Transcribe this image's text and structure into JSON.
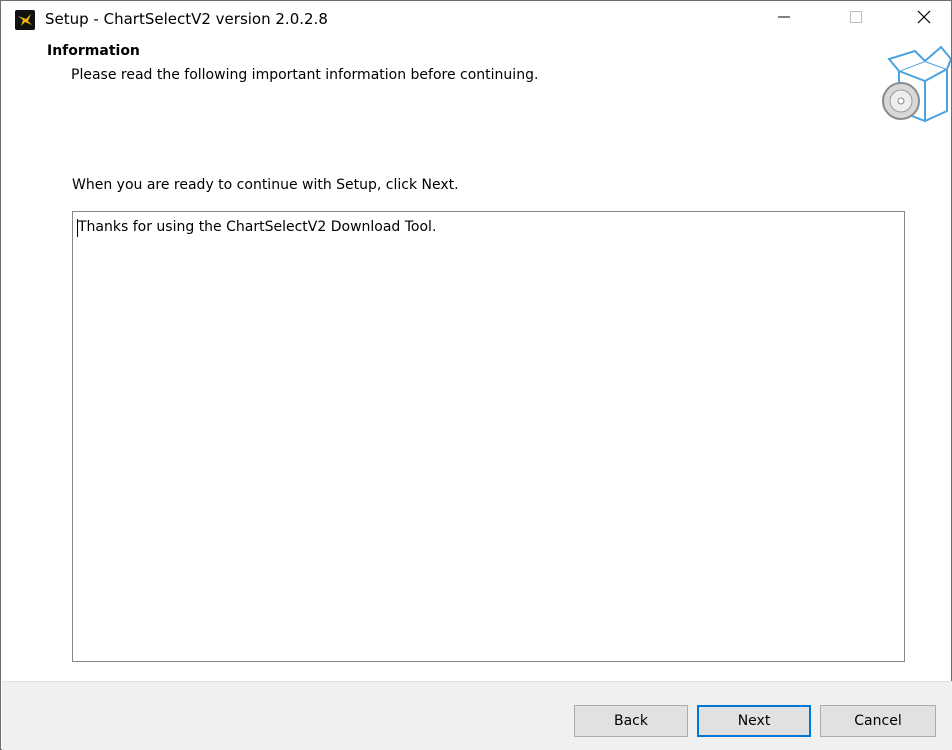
{
  "window": {
    "title": "Setup - ChartSelectV2 version 2.0.2.8"
  },
  "header": {
    "title": "Information",
    "subtitle": "Please read the following important information before continuing."
  },
  "main": {
    "instruction": "When you are ready to continue with Setup, click Next.",
    "memo_text": "Thanks for using the ChartSelectV2 Download Tool."
  },
  "footer": {
    "back_label": "Back",
    "next_label": "Next",
    "cancel_label": "Cancel"
  },
  "colors": {
    "accent": "#0078d7",
    "footer_bg": "#f0f0f0",
    "button_bg": "#e1e1e1"
  },
  "icons": {
    "app": "hummingbird-app-icon",
    "header": "box-with-disc-icon",
    "minimize": "minimize-icon",
    "maximize": "maximize-icon",
    "close": "close-icon"
  }
}
